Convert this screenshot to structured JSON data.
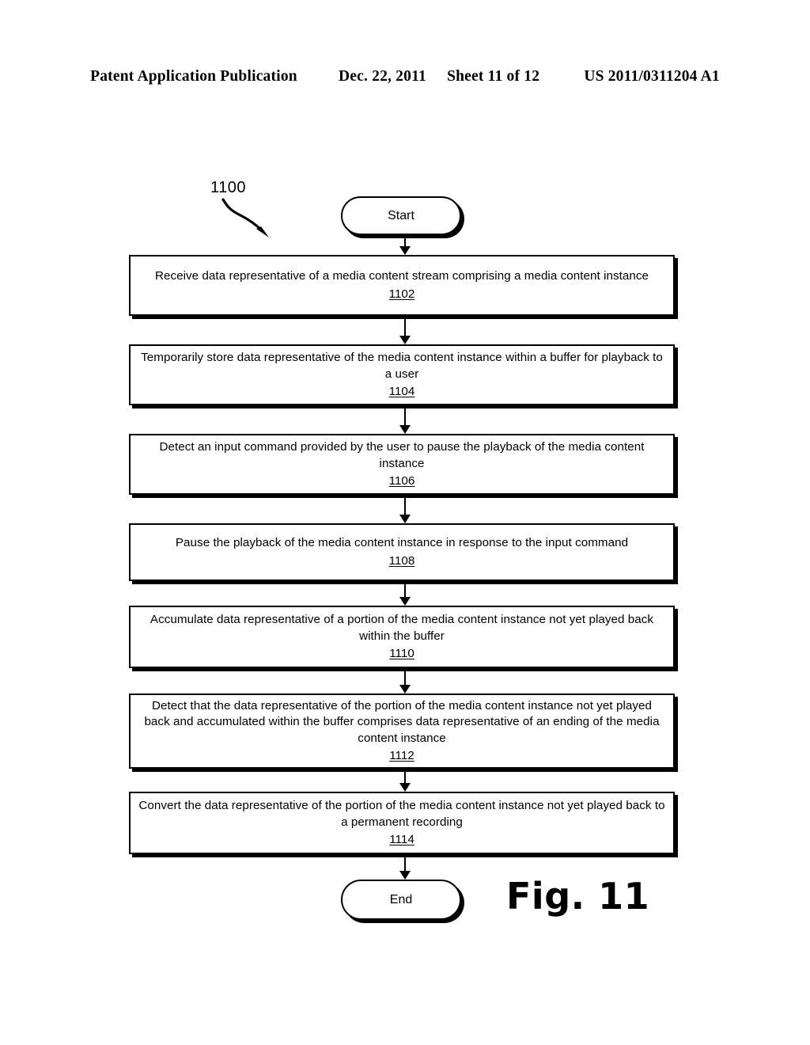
{
  "header": {
    "publication": "Patent Application Publication",
    "date": "Dec. 22, 2011",
    "sheet": "Sheet 11 of 12",
    "patent_number": "US 2011/0311204 A1"
  },
  "figure": {
    "caption": "Fig. 11",
    "reference_numeral": "1100"
  },
  "flowchart": {
    "start_label": "Start",
    "end_label": "End",
    "steps": [
      {
        "id": "1102",
        "text": "Receive data representative of a media content stream comprising a media content instance",
        "number": "1102"
      },
      {
        "id": "1104",
        "text": "Temporarily store data representative of the media content instance within a buffer for playback to a user",
        "number": "1104"
      },
      {
        "id": "1106",
        "text": "Detect an input command provided by the user to pause the playback of the media content instance",
        "number": "1106"
      },
      {
        "id": "1108",
        "text": "Pause the playback of the media content instance in response to the input command",
        "number": "1108"
      },
      {
        "id": "1110",
        "text": "Accumulate data representative of a portion of the media content instance not yet played back within the buffer",
        "number": "1110"
      },
      {
        "id": "1112",
        "text": "Detect that the data representative of the portion of the media content instance not yet played back and accumulated within the buffer comprises data representative of an ending of the media content instance",
        "number": "1112"
      },
      {
        "id": "1114",
        "text": "Convert the data representative of the portion of the media content instance not yet played back to a permanent recording",
        "number": "1114"
      }
    ]
  },
  "colors": {
    "ink": "#000000",
    "paper": "#ffffff"
  }
}
